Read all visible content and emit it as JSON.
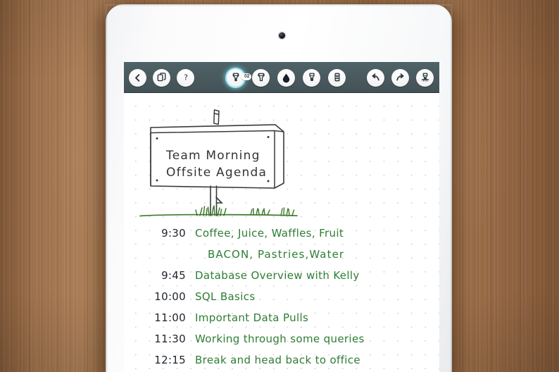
{
  "device": {
    "name": "tablet",
    "camera": "front-camera"
  },
  "toolbar": {
    "background_color": "#49595d",
    "left_buttons": [
      {
        "name": "back-button",
        "icon": "back-chevron-icon",
        "label": "<"
      },
      {
        "name": "copy-button",
        "icon": "copy-pages-icon",
        "label": "Copy"
      },
      {
        "name": "help-button",
        "icon": "question-mark-icon",
        "label": "?"
      }
    ],
    "tool_buttons": [
      {
        "name": "pen-tool",
        "icon": "pen-nib-icon",
        "selected": true,
        "badge": "02"
      },
      {
        "name": "marker-tool",
        "icon": "marker-tip-icon",
        "selected": false
      },
      {
        "name": "ink-color-tool",
        "icon": "ink-drop-icon",
        "selected": false
      },
      {
        "name": "pencil-tool",
        "icon": "pencil-texture-icon",
        "selected": false
      },
      {
        "name": "eraser-tool",
        "icon": "eraser-icon",
        "selected": false
      }
    ],
    "right_buttons": [
      {
        "name": "undo-button",
        "icon": "undo-arrow-icon"
      },
      {
        "name": "redo-button",
        "icon": "redo-arrow-icon"
      },
      {
        "name": "stylus-settings-button",
        "icon": "stylus-icon"
      }
    ],
    "selected_glow_color": "#9fe6f5"
  },
  "note": {
    "paper": "dotted-grid",
    "ink_colors": {
      "time": "#20262e",
      "text": "#2f7d34",
      "sign": "#343434",
      "grass": "#3f7a2e"
    },
    "sign": {
      "name": "signpost-drawing",
      "line1": "Team Morning",
      "line2": "Offsite Agenda"
    },
    "agenda": [
      {
        "time": "9:30",
        "text": "Coffee, Juice, Waffles, Fruit",
        "continuation": false
      },
      {
        "time": "",
        "text": "BACON,  Pastries,Water",
        "continuation": true
      },
      {
        "time": "9:45",
        "text": "Database Overview with Kelly",
        "continuation": false
      },
      {
        "time": "10:00",
        "text": "SQL Basics",
        "continuation": false
      },
      {
        "time": "11:00",
        "text": "Important Data Pulls",
        "continuation": false
      },
      {
        "time": "11:30",
        "text": "Working through some queries",
        "continuation": false
      },
      {
        "time": "12:15",
        "text": "Break and head back to office",
        "continuation": false
      }
    ]
  }
}
